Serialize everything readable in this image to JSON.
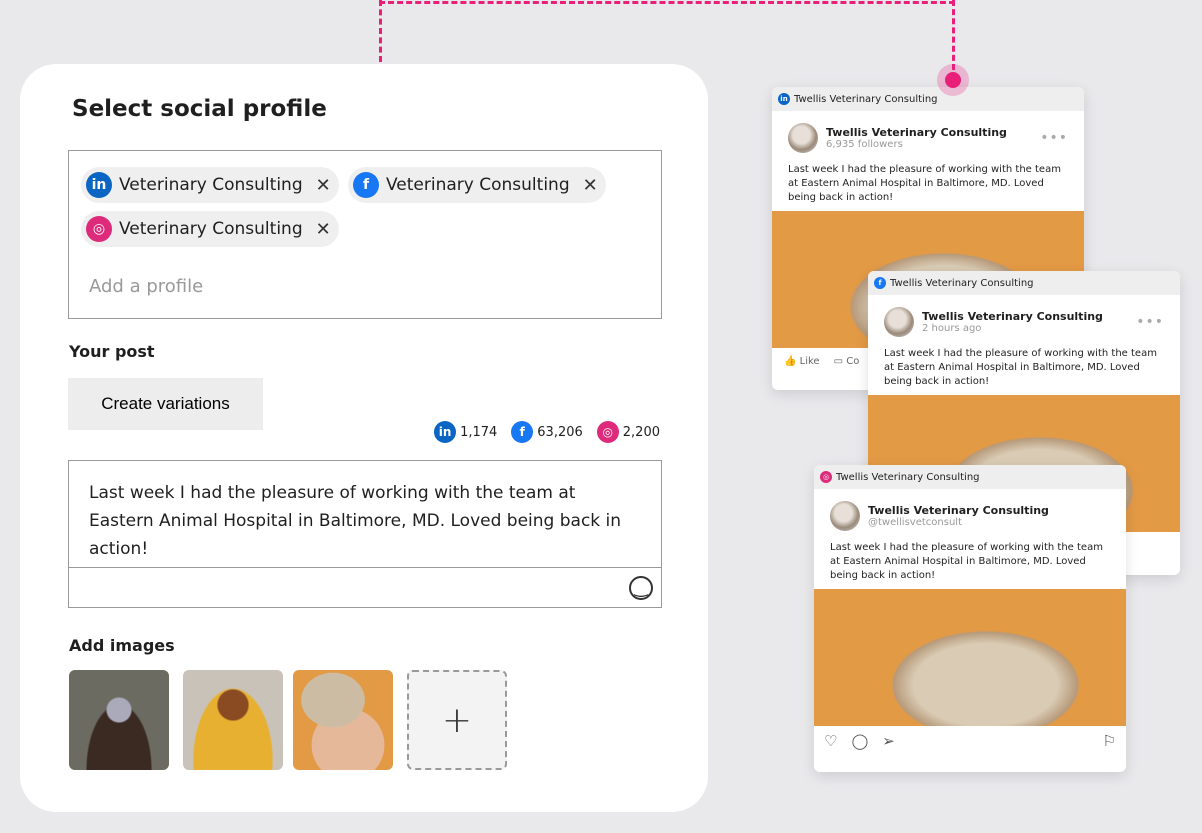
{
  "composer": {
    "title": "Select social profile",
    "profiles": [
      {
        "network": "linkedin",
        "icon": "linkedin-icon",
        "label": "Veterinary Consulting"
      },
      {
        "network": "facebook",
        "icon": "facebook-icon",
        "label": "Veterinary Consulting"
      },
      {
        "network": "instagram",
        "icon": "instagram-icon",
        "label": "Veterinary Consulting"
      }
    ],
    "add_profile_placeholder": "Add a profile",
    "your_post_label": "Your post",
    "create_variations_label": "Create variations",
    "counts": {
      "linkedin": "1,174",
      "facebook": "63,206",
      "instagram": "2,200"
    },
    "post_text": "Last week I had the pleasure of working with the team at Eastern Animal Hospital in Baltimore, MD. Loved being back in action!",
    "add_images_label": "Add images",
    "add_image_symbol": "+"
  },
  "previews": {
    "linkedin": {
      "header": "Twellis Veterinary Consulting",
      "name": "Twellis Veterinary Consulting",
      "sub": "6,935 followers",
      "text": "Last week I had the pleasure of working with the team at Eastern Animal Hospital in Baltimore, MD. Loved being back in action!",
      "like": "Like",
      "comment": "Co"
    },
    "facebook": {
      "header": "Twellis Veterinary Consulting",
      "name": "Twellis Veterinary Consulting",
      "sub": "2 hours ago",
      "text": "Last week I had the pleasure of working with the team at Eastern Animal Hospital in Baltimore, MD. Loved being back in action!"
    },
    "instagram": {
      "header": "Twellis Veterinary Consulting",
      "name": "Twellis Veterinary Consulting",
      "sub": "@twellisvetconsult",
      "text": "Last week I had the pleasure of working with the team at Eastern Animal Hospital in Baltimore, MD. Loved being back in action!"
    }
  },
  "colors": {
    "accent": "#e8207a",
    "linkedin": "#0a66c2",
    "facebook": "#1877f2",
    "instagram": "#dd2a7b"
  }
}
